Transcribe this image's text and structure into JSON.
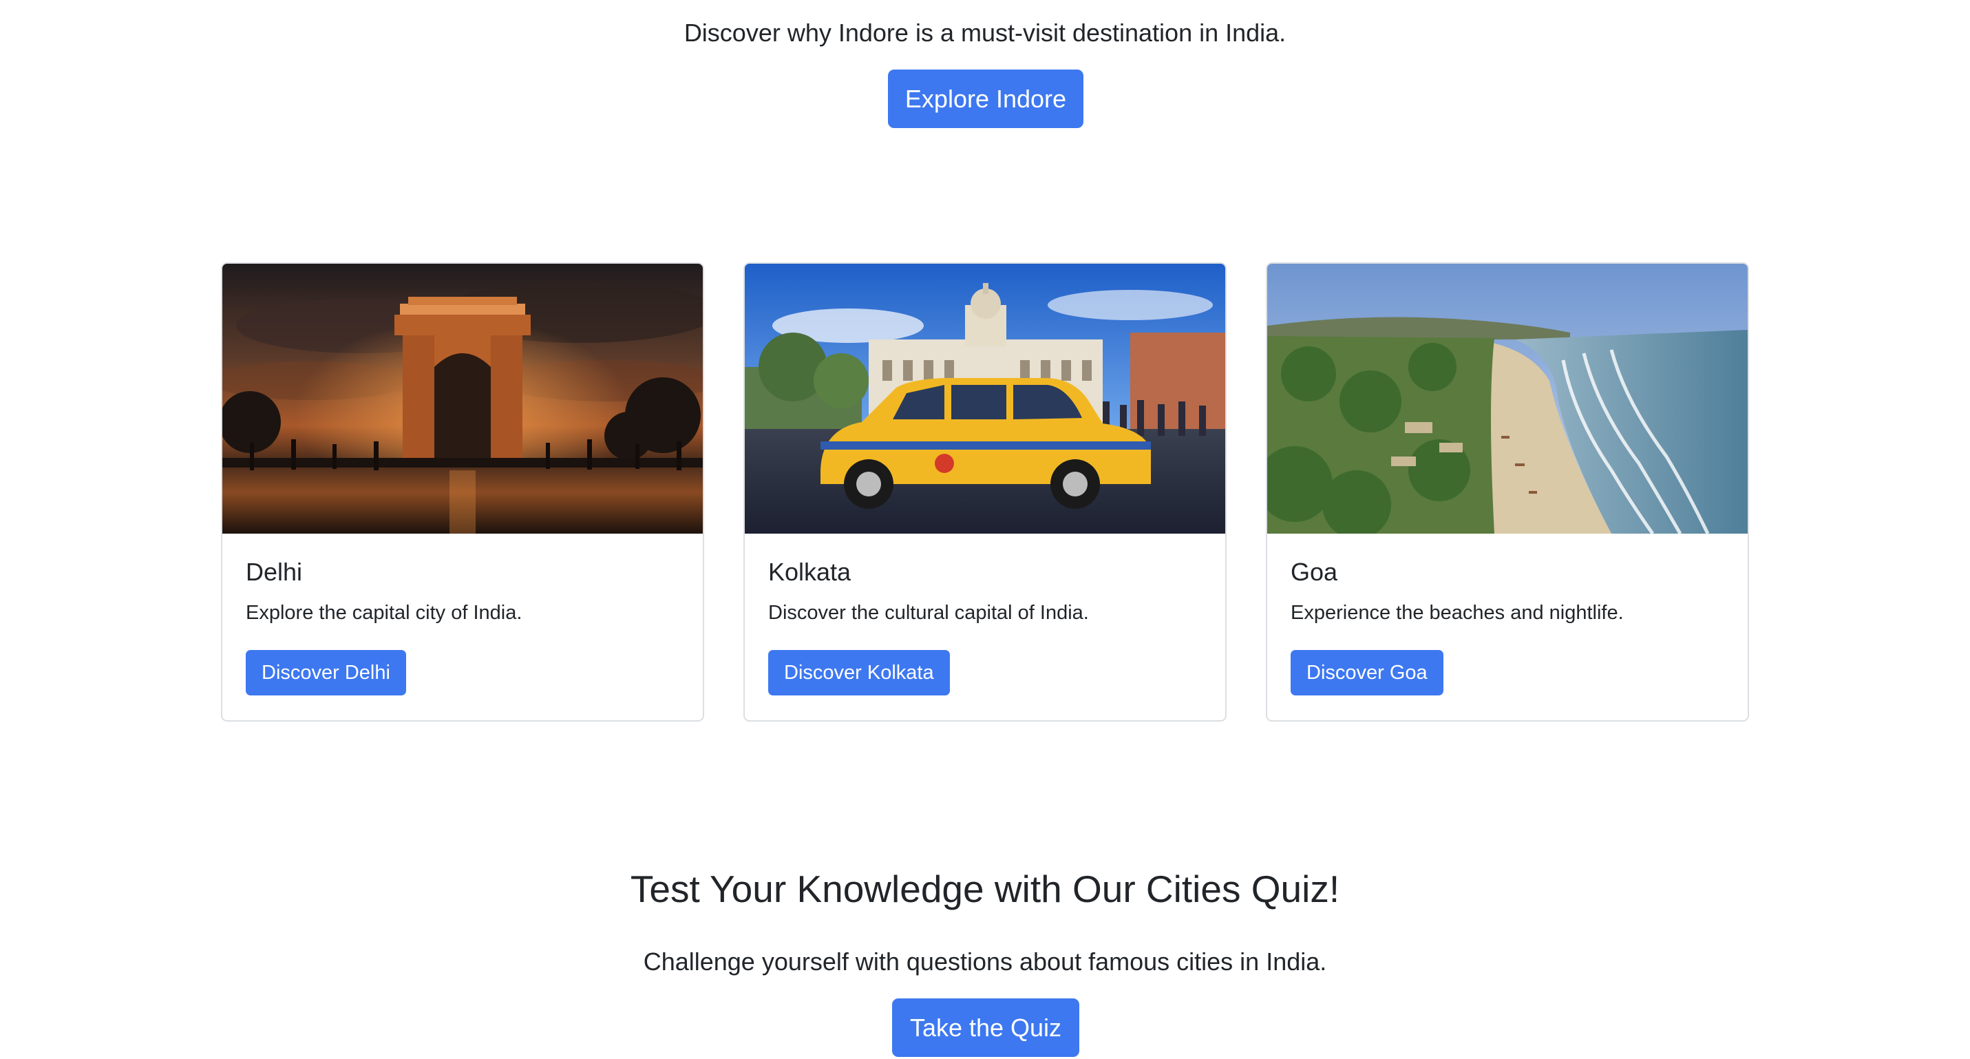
{
  "hero": {
    "subtitle": "Discover why Indore is a must-visit destination in India.",
    "button_label": "Explore Indore"
  },
  "cards": [
    {
      "image": "india-gate-photo",
      "title": "Delhi",
      "text": "Explore the capital city of India.",
      "button_label": "Discover Delhi"
    },
    {
      "image": "kolkata-yellow-taxi-photo",
      "title": "Kolkata",
      "text": "Discover the cultural capital of India.",
      "button_label": "Discover Kolkata"
    },
    {
      "image": "goa-beach-photo",
      "title": "Goa",
      "text": "Experience the beaches and nightlife.",
      "button_label": "Discover Goa"
    }
  ],
  "quiz": {
    "title": "Test Your Knowledge with Our Cities Quiz!",
    "subtitle": "Challenge yourself with questions about famous cities in India.",
    "button_label": "Take the Quiz"
  },
  "colors": {
    "primary": "#3d78f0",
    "text": "#212529",
    "card_border": "#dcdfe3"
  }
}
